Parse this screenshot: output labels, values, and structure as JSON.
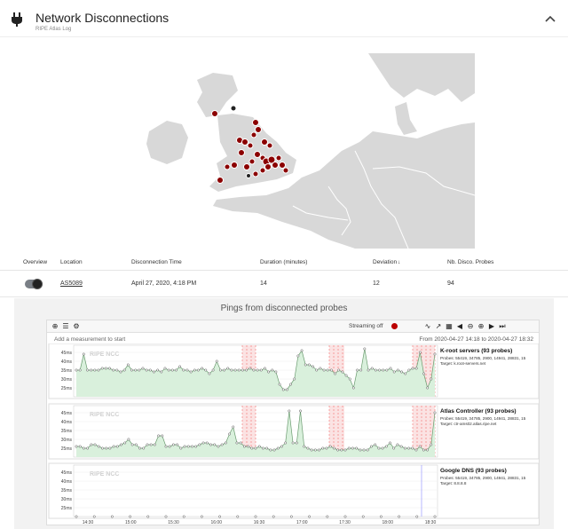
{
  "header": {
    "title": "Network Disconnections",
    "subtitle": "RIPE Atlas Log",
    "icon": "plug-icon",
    "collapse_icon": "chevron-up-icon"
  },
  "table": {
    "columns": [
      "Overview",
      "Location",
      "Disconnection Time",
      "Duration (minutes)",
      "Deviation",
      "Nb. Disco. Probes"
    ],
    "sort_indicator": "↓",
    "rows": [
      {
        "location": "AS5089",
        "time": "April 27, 2020, 4:18 PM",
        "duration": "14",
        "deviation": "12",
        "probes": "94"
      }
    ]
  },
  "panel": {
    "title": "Pings from disconnected probes",
    "add_measurement": "Add a measurement to start",
    "streaming_label": "Streaming off",
    "range": "From 2020-04-27 14:18 to 2020-04-27 18:32",
    "watermark": "RIPE NCC"
  },
  "charts": [
    {
      "title": "K-root servers (93 probes)",
      "probes": "Probes: 55419, 34785, 2900, 14941, 28831, 15",
      "target": "Target: k.root-servers.net"
    },
    {
      "title": "Atlas Controller (93 probes)",
      "probes": "Probes: 55419, 34785, 2900, 14941, 28831, 15",
      "target": "Target: ctr-ams02.atlas.ripe.net"
    },
    {
      "title": "Google DNS (93 probes)",
      "probes": "Probes: 55419, 34785, 2900, 14941, 28831, 15",
      "target": "Target: 8.8.8.8"
    }
  ],
  "chart_data": {
    "type": "line",
    "y_ticks": [
      "45ms",
      "40ms",
      "35ms",
      "30ms",
      "25ms"
    ],
    "x_ticks": [
      "14:30",
      "15:00",
      "15:30",
      "16:00",
      "16:30",
      "17:00",
      "17:30",
      "18:00",
      "18:30"
    ],
    "series": [
      {
        "name": "K-root servers (93 probes)",
        "values": [
          35,
          35,
          44,
          35,
          35,
          35,
          35,
          36,
          36,
          36,
          35,
          35,
          34,
          35,
          38,
          35,
          35,
          35,
          36,
          35,
          35,
          34,
          35,
          34,
          36,
          35,
          35,
          35,
          37,
          35,
          35,
          34,
          35,
          35,
          36,
          35,
          33,
          35,
          40,
          35,
          35,
          36,
          35,
          35,
          35,
          35,
          35,
          36,
          35,
          35,
          35,
          36,
          34,
          35,
          34,
          27,
          24,
          24,
          27,
          30,
          43,
          46,
          38,
          38,
          37,
          35,
          36,
          35,
          35,
          35,
          33,
          35,
          34,
          32,
          30,
          25,
          35,
          35,
          47,
          35,
          36,
          35,
          35,
          35,
          35,
          36,
          34,
          35,
          34,
          33,
          35,
          36,
          36,
          45,
          33,
          25,
          30,
          44
        ]
      },
      {
        "name": "Atlas Controller (93 probes)",
        "values": [
          26,
          26,
          25,
          25,
          27,
          27,
          26,
          25,
          25,
          25,
          26,
          26,
          27,
          28,
          30,
          27,
          27,
          25,
          25,
          27,
          27,
          27,
          32,
          32,
          26,
          26,
          27,
          27,
          25,
          26,
          26,
          26,
          26,
          27,
          28,
          28,
          27,
          27,
          26,
          27,
          28,
          33,
          37,
          28,
          28,
          26,
          26,
          25,
          25,
          26,
          25,
          25,
          24,
          24,
          25,
          26,
          28,
          46,
          28,
          28,
          46,
          26,
          25,
          24,
          24,
          24,
          25,
          25,
          26,
          25,
          24,
          24,
          24,
          25,
          25,
          25,
          24,
          24,
          24,
          26,
          27,
          25,
          25,
          26,
          28,
          25,
          27,
          26,
          25,
          25,
          25,
          24,
          26,
          24,
          24,
          27,
          45
        ]
      },
      {
        "name": "Google DNS (93 probes)",
        "values": [
          20,
          20,
          20,
          20,
          20,
          20,
          20,
          20,
          20,
          20,
          20,
          20,
          20,
          20,
          20,
          20,
          20,
          20,
          20,
          20,
          20
        ]
      }
    ],
    "ylim": [
      20,
      48
    ]
  }
}
